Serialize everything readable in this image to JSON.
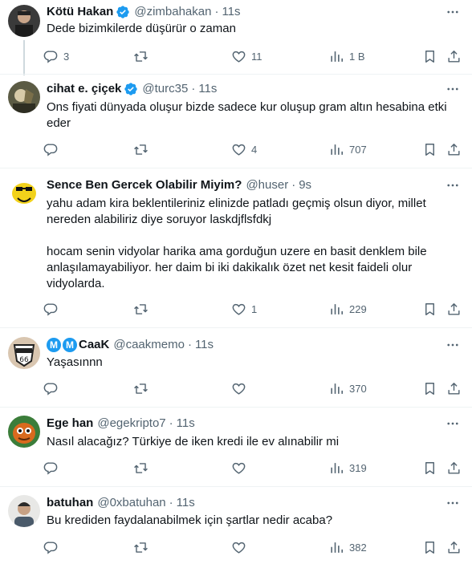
{
  "tweets": [
    {
      "name": "Kötü Hakan",
      "verified": true,
      "handle": "@zimbahakan",
      "time": "11s",
      "text": "Dede bizimkilerde düşürür o zaman",
      "replies": "3",
      "retweets": "",
      "likes": "11",
      "views": "1 B"
    },
    {
      "name": "cihat e. çiçek",
      "verified": true,
      "handle": "@turc35",
      "time": "11s",
      "text": "Ons fiyati dünyada oluşur bizde sadece kur oluşup gram altın hesabina etki eder",
      "replies": "",
      "retweets": "",
      "likes": "4",
      "views": "707"
    },
    {
      "name": "Sence Ben Gercek Olabilir Miyim?",
      "verified": false,
      "handle": "@huser",
      "time": "9s",
      "text": "yahu adam kira beklentileriniz elinizde patladı geçmiş olsun diyor, millet nereden alabiliriz diye soruyor laskdjflsfdkj\n\nhocam senin vidyolar harika ama gorduğun uzere en basit denklem bile anlaşılamayabiliyor. her daim bi iki dakikalık özet net kesit faideli olur vidyolarda.",
      "replies": "",
      "retweets": "",
      "likes": "1",
      "views": "229"
    },
    {
      "name": "CaaK",
      "name_badges": [
        "M",
        "M"
      ],
      "verified": false,
      "handle": "@caakmemo",
      "time": "11s",
      "text": "Yaşasınnn",
      "replies": "",
      "retweets": "",
      "likes": "",
      "views": "370"
    },
    {
      "name": "Ege han",
      "verified": false,
      "handle": "@egekripto7",
      "time": "11s",
      "text": "Nasıl alacağız? Türkiye de iken kredi ile ev alınabilir mi",
      "replies": "",
      "retweets": "",
      "likes": "",
      "views": "319"
    },
    {
      "name": "batuhan",
      "verified": false,
      "handle": "@0xbatuhan",
      "time": "11s",
      "text": "Bu krediden faydalanabilmek için şartlar nedir acaba?",
      "replies": "",
      "retweets": "",
      "likes": "",
      "views": "382"
    }
  ],
  "colors": {
    "text": "#0f1419",
    "secondary": "#536471",
    "verified": "#1d9bf0",
    "separator": "#eff3f4",
    "thread_line": "#cfd9de"
  },
  "icons": [
    "reply-icon",
    "retweet-icon",
    "like-icon",
    "views-icon",
    "bookmark-icon",
    "share-icon",
    "more-icon",
    "verified-icon"
  ]
}
